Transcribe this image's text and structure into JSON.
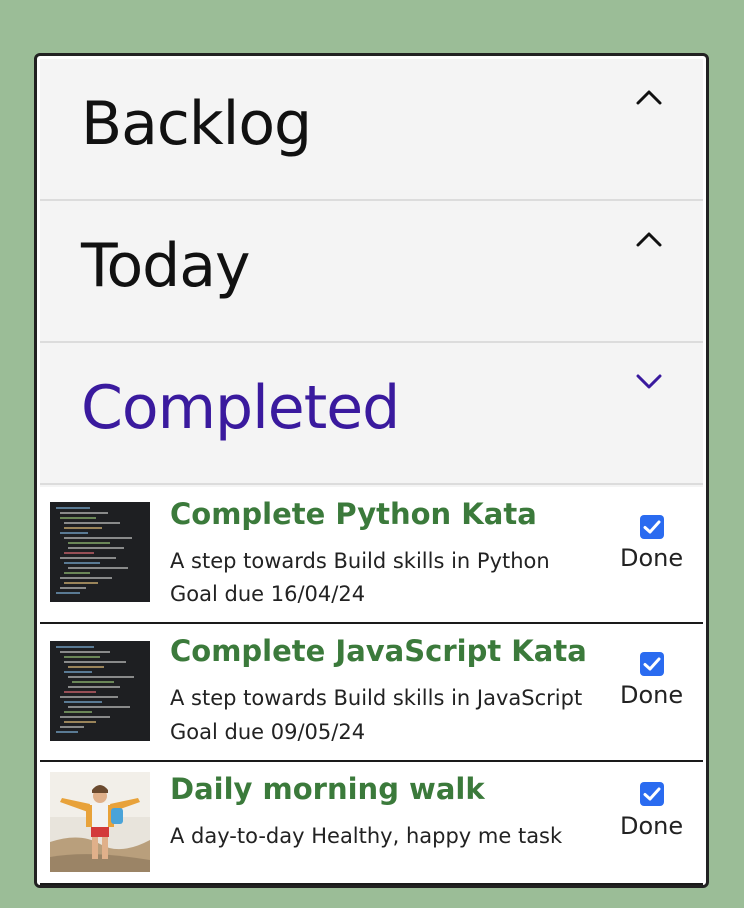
{
  "sections": [
    {
      "title": "Backlog",
      "chevron": "chevron-up-icon"
    },
    {
      "title": "Today",
      "chevron": "chevron-up-icon"
    },
    {
      "title": "Completed",
      "chevron": "chevron-down-icon"
    }
  ],
  "colors": {
    "background": "#9bbd97",
    "active_section": "#3a1a9e",
    "task_title": "#3b7a3b",
    "checkbox": "#2a6bf0"
  },
  "tasks": [
    {
      "title": "Complete Python Kata",
      "description": "A step towards Build skills in Python",
      "due": "Goal due 16/04/24",
      "status": "Done",
      "checked": true,
      "thumbnail": "code-screenshot"
    },
    {
      "title": "Complete JavaScript Kata",
      "description": "A step towards Build skills in JavaScript",
      "due": "Goal due 09/05/24",
      "status": "Done",
      "checked": true,
      "thumbnail": "code-screenshot"
    },
    {
      "title": "Daily morning walk",
      "description": "A day-to-day Healthy, happy me task",
      "due": "",
      "status": "Done",
      "checked": true,
      "thumbnail": "walker-photo"
    }
  ]
}
